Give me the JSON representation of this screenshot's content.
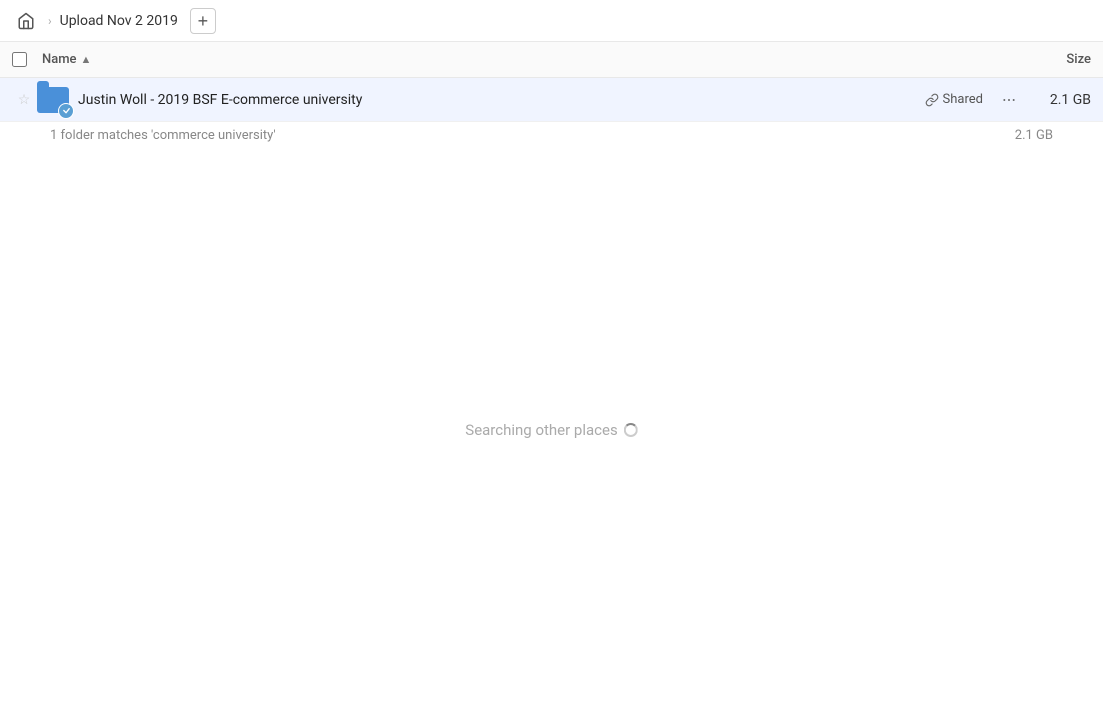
{
  "header": {
    "home_icon": "home",
    "breadcrumb_arrow": "›",
    "breadcrumb_label": "Upload Nov 2 2019",
    "add_button_label": "+"
  },
  "columns": {
    "name_label": "Name",
    "sort_arrow": "▲",
    "size_label": "Size"
  },
  "file_row": {
    "star_icon": "☆",
    "folder_icon": "folder",
    "file_name": "Justin Woll - 2019 BSF E-commerce university",
    "shared_label": "Shared",
    "more_icon": "•••",
    "file_size": "2.1 GB"
  },
  "search_info": {
    "text": "1 folder matches 'commerce university'",
    "size": "2.1 GB"
  },
  "searching": {
    "text": "Searching other places",
    "spinner": true
  }
}
